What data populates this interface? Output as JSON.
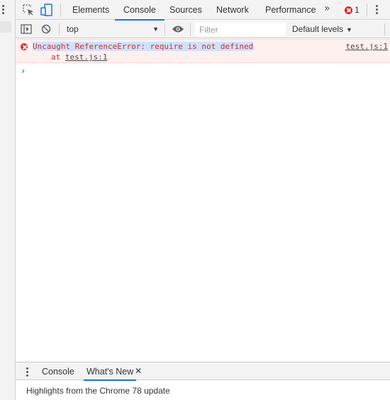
{
  "tabbar": {
    "tabs": [
      {
        "label": "Elements",
        "active": false
      },
      {
        "label": "Console",
        "active": true
      },
      {
        "label": "Sources",
        "active": false
      },
      {
        "label": "Network",
        "active": false
      },
      {
        "label": "Performance",
        "active": false
      }
    ],
    "more_icon": "chevron-double-right-icon",
    "error_count": "1",
    "accent_color": "#1a73e8",
    "error_color": "#e02424"
  },
  "console_toolbar": {
    "context": "top",
    "filter_placeholder": "Filter",
    "levels_label": "Default levels"
  },
  "messages": [
    {
      "level": "error",
      "text": "Uncaught ReferenceError: require is not defined",
      "stack_prefix": "at ",
      "stack_link": "test.js:1",
      "source": "test.js:1"
    }
  ],
  "drawer": {
    "tabs": [
      {
        "label": "Console",
        "active": false
      },
      {
        "label": "What's New",
        "active": true,
        "closable": true
      }
    ],
    "body_text": "Highlights from the Chrome 78 update"
  }
}
